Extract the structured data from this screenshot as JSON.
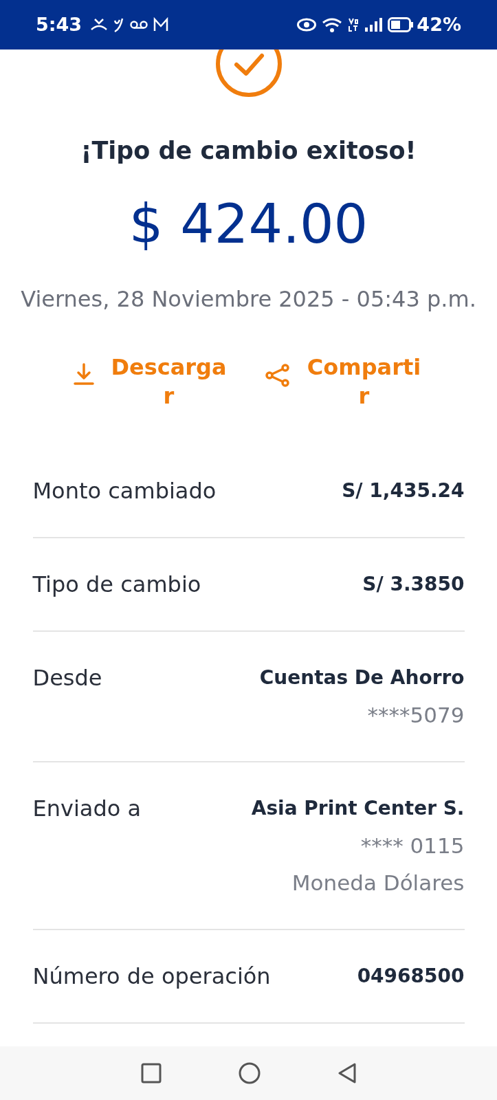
{
  "status_bar": {
    "time": "5:43",
    "battery": "42%"
  },
  "title": "¡Tipo de cambio exitoso!",
  "amount": "$ 424.00",
  "date": "Viernes, 28 Noviembre 2025 - 05:43 p.m.",
  "actions": [
    {
      "kind": "download",
      "label": "Descargar"
    },
    {
      "kind": "share",
      "label": "Compartir"
    }
  ],
  "details": [
    {
      "label": "Monto cambiado",
      "value": "S/ 1,435.24"
    },
    {
      "label": "Tipo de cambio",
      "value": "S/ 3.3850"
    },
    {
      "label": "Desde",
      "value": "Cuentas De Ahorro",
      "sub": [
        "****5079"
      ]
    },
    {
      "label": "Enviado a",
      "value": "Asia Print Center S.",
      "sub": [
        "**** 0115",
        "Moneda Dólares"
      ]
    },
    {
      "label": "Número de operación",
      "value": "04968500"
    }
  ]
}
